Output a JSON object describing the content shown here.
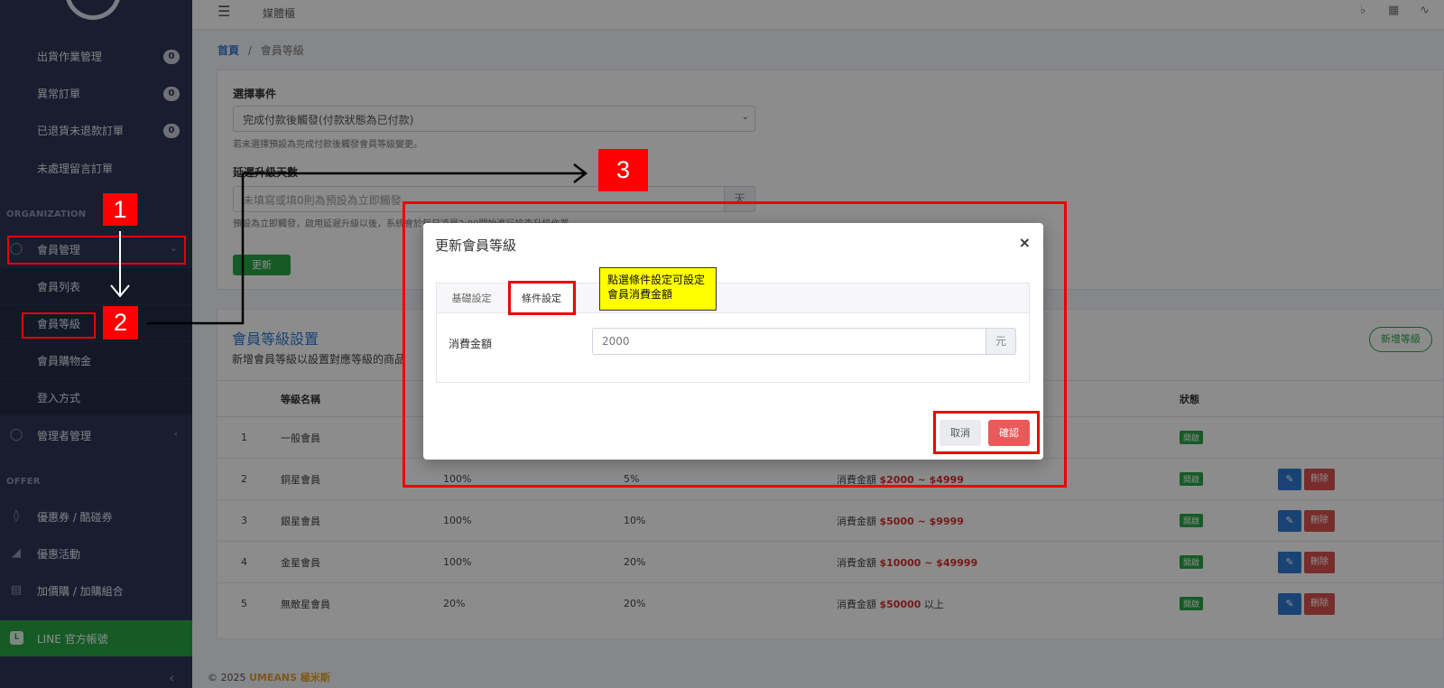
{
  "sidebar": {
    "items_top": [
      {
        "label": "出貨作業管理",
        "badge": "0"
      },
      {
        "label": "異常訂單",
        "badge": "0"
      },
      {
        "label": "已退貨未退款訂單",
        "badge": "0"
      },
      {
        "label": "未處理留言訂單"
      }
    ],
    "section_org": "ORGANIZATION",
    "member_mgmt": "會員管理",
    "member_sub": [
      "會員列表",
      "會員等級",
      "會員購物金",
      "登入方式"
    ],
    "admin_mgmt": "管理者管理",
    "section_offer": "OFFER",
    "offer_items": [
      "優惠券 / 酷碰券",
      "優惠活動",
      "加價購 / 加購組合"
    ],
    "line_btn": "LINE 官方帳號"
  },
  "topbar": {
    "title": "媒體櫃"
  },
  "breadcrumb": {
    "home": "首頁",
    "sep": "/",
    "current": "會員等級"
  },
  "settings": {
    "event_label": "選擇事件",
    "event_value": "完成付款後觸發(付款狀態為已付款)",
    "event_help": "若未選擇預設為完成付款後觸發會員等級變更。",
    "delay_label": "延遲升級天數",
    "delay_placeholder": "未填寫或填0則為預設為立即觸發",
    "delay_unit": "天",
    "delay_help": "預設為立即觸發，啟用延遲升級以後，系統會於每日凌晨2:00開始進行檢查升級作業。",
    "update_btn": "更新"
  },
  "levels_section": {
    "title": "會員等級設置",
    "desc": "新增會員等級以設置對應等級的商品折扣",
    "add_btn": "新增等級",
    "headers": [
      "",
      "等級名稱",
      "",
      "",
      "",
      "狀態",
      ""
    ],
    "status_label": "開啟",
    "delete_label": "刪除",
    "rows": [
      {
        "no": "1",
        "name": "一般會員",
        "c1": "",
        "c2": "",
        "prefix": "",
        "money": "",
        "suffix": ""
      },
      {
        "no": "2",
        "name": "銅星會員",
        "c1": "100%",
        "c2": "5%",
        "prefix": "消費金額 ",
        "money": "$2000 ~ $4999",
        "suffix": ""
      },
      {
        "no": "3",
        "name": "銀星會員",
        "c1": "100%",
        "c2": "10%",
        "prefix": "消費金額 ",
        "money": "$5000 ~ $9999",
        "suffix": ""
      },
      {
        "no": "4",
        "name": "金星會員",
        "c1": "100%",
        "c2": "20%",
        "prefix": "消費金額 ",
        "money": "$10000 ~ $49999",
        "suffix": ""
      },
      {
        "no": "5",
        "name": "無敵星會員",
        "c1": "20%",
        "c2": "20%",
        "prefix": "消費金額 ",
        "money": "$50000",
        "suffix": " 以上"
      }
    ]
  },
  "footer": {
    "copy": "© 2025",
    "brand": "UMEANS 極米斯"
  },
  "modal": {
    "title": "更新會員等級",
    "close": "×",
    "tab_basic": "基礎設定",
    "tab_cond": "條件設定",
    "spend_label": "消費金額",
    "spend_value": "2000",
    "spend_unit": "元",
    "cancel": "取消",
    "confirm": "確認"
  },
  "annotations": {
    "tag1": "1",
    "tag2": "2",
    "tag3": "3",
    "note": "點選條件設定可設定會員消費金額"
  },
  "colors": {
    "sidebar": "#2c3656",
    "accent_blue": "#2f7ad6",
    "success_green": "#28a745",
    "danger_red": "#d9534f",
    "annotation_red": "#ff0000",
    "note_yellow": "#ffff00"
  }
}
